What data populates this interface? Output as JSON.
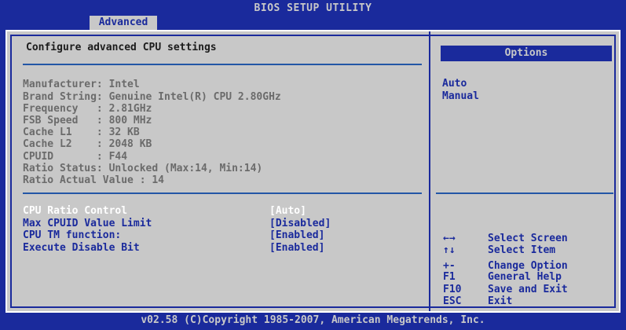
{
  "title": "BIOS SETUP UTILITY",
  "active_tab": "Advanced",
  "main": {
    "heading": "Configure advanced CPU settings",
    "info": [
      "Manufacturer: Intel",
      "Brand String: Genuine Intel(R) CPU 2.80GHz",
      "Frequency   : 2.81GHz",
      "FSB Speed   : 800 MHz",
      "Cache L1    : 32 KB",
      "Cache L2    : 2048 KB",
      "CPUID       : F44",
      "Ratio Status: Unlocked (Max:14, Min:14)",
      "Ratio Actual Value : 14"
    ],
    "settings": [
      {
        "label": "CPU Ratio Control",
        "value": "[Auto]"
      },
      {
        "label": "Max CPUID Value Limit",
        "value": "[Disabled]"
      },
      {
        "label": "CPU TM function:",
        "value": "[Enabled]"
      },
      {
        "label": "Execute Disable Bit",
        "value": "[Enabled]"
      }
    ]
  },
  "options": {
    "header": "Options",
    "items": [
      "Auto",
      "Manual"
    ]
  },
  "help": [
    {
      "key": "←→",
      "text": "Select Screen"
    },
    {
      "key": "↑↓",
      "text": "Select Item"
    },
    {
      "key": "+-",
      "text": "Change Option"
    },
    {
      "key": "F1",
      "text": "General Help"
    },
    {
      "key": "F10",
      "text": "Save and Exit"
    },
    {
      "key": "ESC",
      "text": "Exit"
    }
  ],
  "footer": "v02.58 (C)Copyright 1985-2007, American Megatrends, Inc.",
  "colors": {
    "background": "#1a2a9c",
    "panel": "#c8c8c8",
    "highlight": "#ffffff"
  }
}
